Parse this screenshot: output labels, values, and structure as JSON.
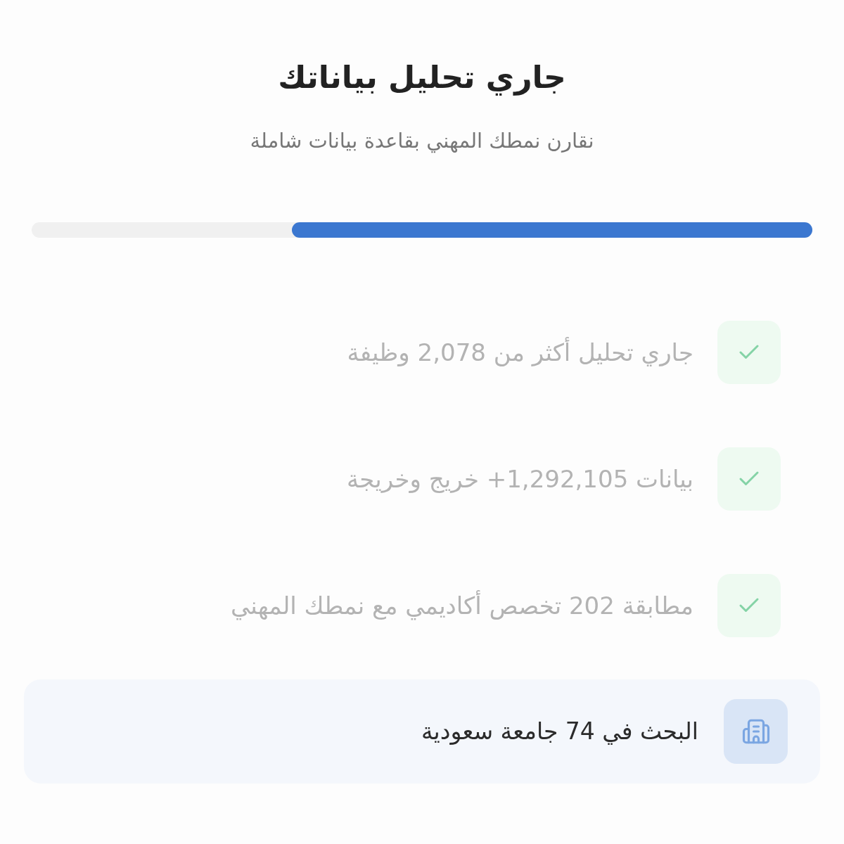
{
  "header": {
    "title": "جاري تحليل بياناتك",
    "subtitle": "نقارن نمطك المهني بقاعدة بيانات شاملة"
  },
  "progress": {
    "level": 0.667
  },
  "steps": [
    {
      "kind": "done",
      "label": "جاري تحليل أكثر من 2,078 وظيفة"
    },
    {
      "kind": "done",
      "label": "بيانات 1,292,105+ خريج وخريجة"
    },
    {
      "kind": "done",
      "label": "مطابقة 202 تخصص أكاديمي مع نمطك المهني"
    },
    {
      "kind": "current",
      "label": "البحث في 74 جامعة سعودية"
    }
  ]
}
